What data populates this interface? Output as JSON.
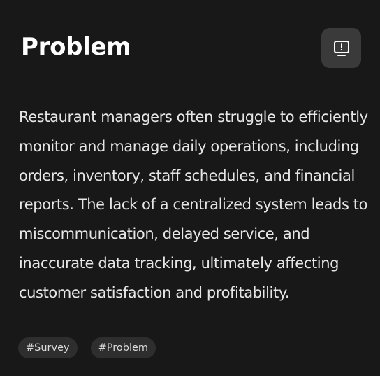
{
  "card": {
    "title": "Problem",
    "icon": "monitor-alert-icon",
    "description": "Restaurant managers often struggle to efficiently monitor and manage daily operations, including orders, inventory, staff schedules, and financial reports. The lack of a centralized system leads to miscommunication, delayed service, and inaccurate data tracking, ultimately affecting customer satisfaction and profitability.",
    "tags": [
      "#Survey",
      "#Problem"
    ]
  },
  "colors": {
    "background": "#181818",
    "icon_button": "#3a3a3a",
    "tag_background": "#2e2e2e",
    "text": "#e6e6e6"
  }
}
